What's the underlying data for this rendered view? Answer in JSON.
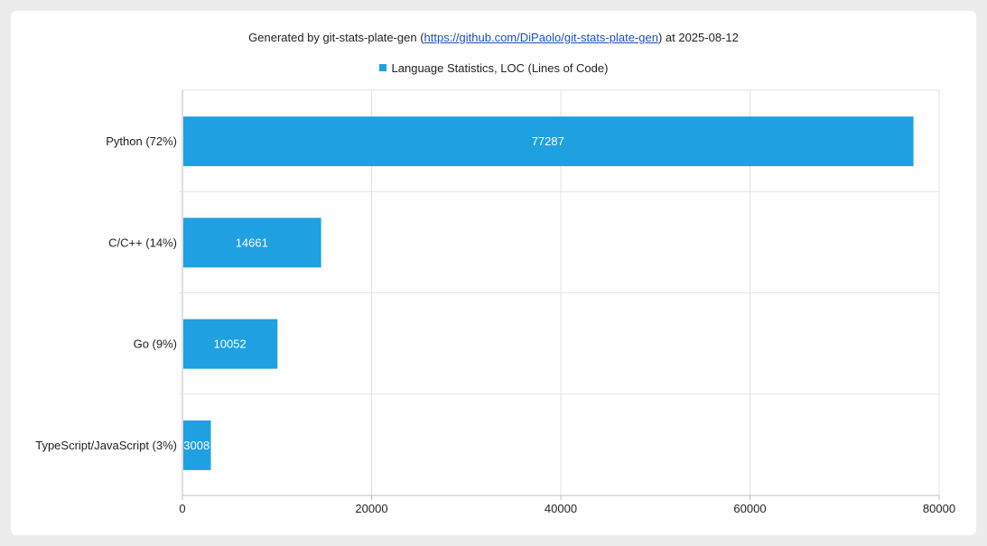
{
  "header": {
    "prefix": "Generated by git-stats-plate-gen (",
    "link_text": "https://github.com/DiPaolo/git-stats-plate-gen",
    "suffix": ") at 2025-08-12"
  },
  "chart_data": {
    "type": "bar",
    "orientation": "horizontal",
    "categories": [
      "Python (72%)",
      "C/C++ (14%)",
      "Go (9%)",
      "TypeScript/JavaScript (3%)"
    ],
    "series": [
      {
        "name": "Language Statistics, LOC (Lines of Code)",
        "values": [
          77287,
          14661,
          10052,
          3008
        ]
      }
    ],
    "xlim": [
      0,
      80000
    ],
    "xticks": [
      0,
      20000,
      40000,
      60000,
      80000
    ],
    "grid": true,
    "legend_position": "top-center",
    "data_labels": true,
    "colors": {
      "bar": "#1fa0e0",
      "grid": "#e3e3e3",
      "axis": "#bdbdbd",
      "label_text": "#ffffff"
    }
  }
}
